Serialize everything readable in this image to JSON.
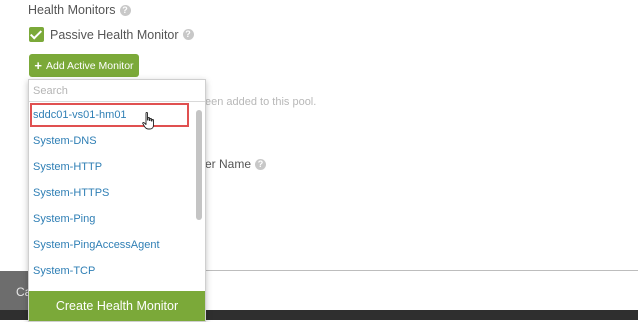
{
  "section": {
    "title": "Health Monitors",
    "passive_label": "Passive Health Monitor",
    "add_active_label": "Add Active Monitor"
  },
  "background": {
    "pool_text_fragment": "een added to this pool.",
    "name_label_fragment": "er Name",
    "footer_fragment": "Ca"
  },
  "dropdown": {
    "search_placeholder": "Search",
    "items": [
      "sddc01-vs01-hm01",
      "System-DNS",
      "System-HTTP",
      "System-HTTPS",
      "System-Ping",
      "System-PingAccessAgent",
      "System-TCP"
    ],
    "highlighted_index": 0,
    "create_label": "Create Health Monitor"
  },
  "colors": {
    "accent_green": "#7ba939",
    "link_blue": "#2f7fb5",
    "highlight_red": "#e05050"
  }
}
